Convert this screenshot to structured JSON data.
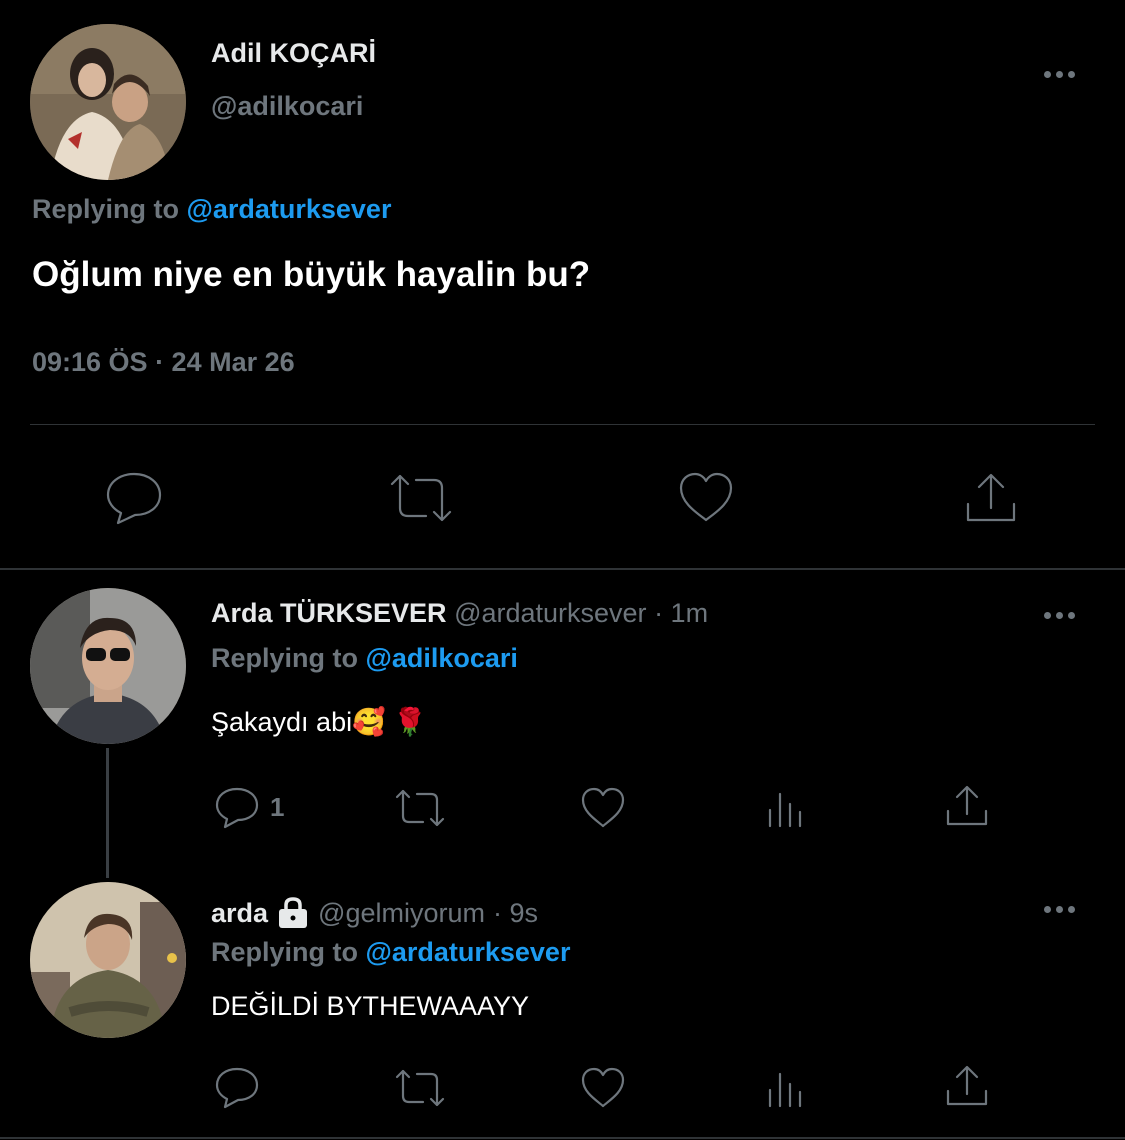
{
  "main_tweet": {
    "author_name": "Adil KOÇARİ",
    "handle": "@adilkocari",
    "replying_prefix": "Replying to",
    "replying_to": "@ardaturksever",
    "text": "Oğlum niye en büyük hayalin bu?",
    "timestamp": "09:16 ÖS · 24 Mar 26",
    "actions": [
      "reply-icon",
      "retweet-icon",
      "like-icon",
      "share-icon"
    ]
  },
  "reply1": {
    "author_name": "Arda TÜRKSEVER",
    "handle": "@ardaturksever",
    "time": "· 1m",
    "replying_prefix": "Replying to",
    "replying_to": "@adilkocari",
    "text": "Şakaydı abi🥰 🌹",
    "reply_count": "1"
  },
  "reply2": {
    "author_name": "arda",
    "handle": "@gelmiyorum",
    "time": "· 9s",
    "replying_prefix": "Replying to",
    "replying_to": "@ardaturksever",
    "text": "DEĞİLDİ BYTHEWAAAYY",
    "protected_icon": "lock-icon"
  },
  "colors": {
    "background": "#000000",
    "text": "#e7e9ea",
    "secondary": "#6e767d",
    "accent": "#1d9bf0",
    "divider": "#2f3336"
  }
}
